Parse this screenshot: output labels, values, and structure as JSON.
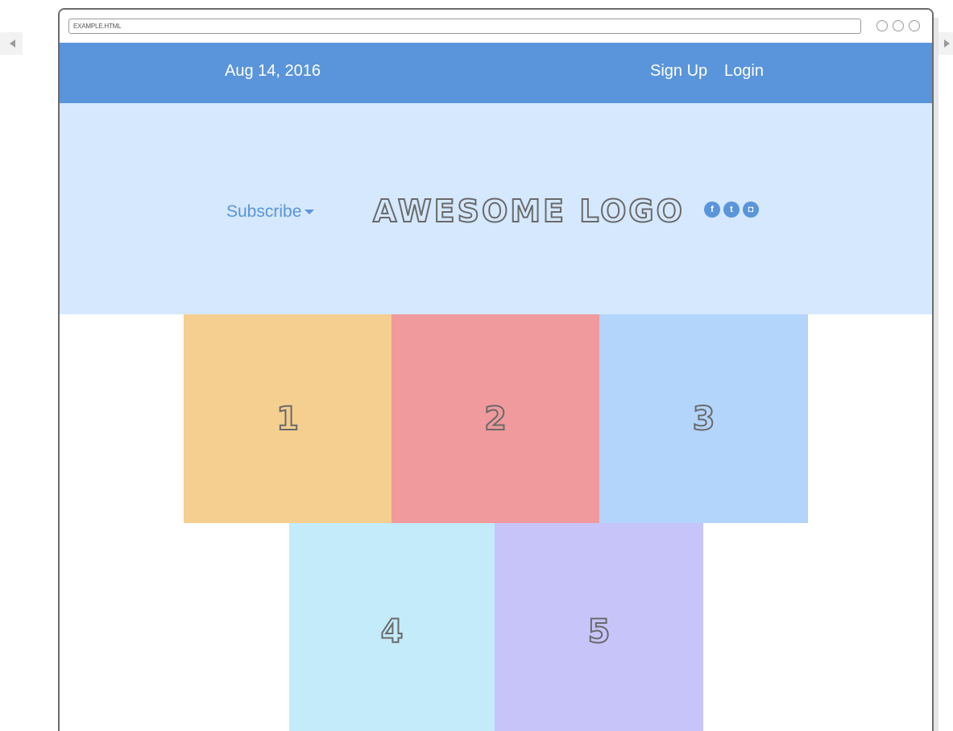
{
  "browser": {
    "url": "EXAMPLE.HTML"
  },
  "header": {
    "date": "Aug 14, 2016",
    "signup_label": "Sign Up",
    "login_label": "Login"
  },
  "hero": {
    "subscribe_label": "Subscribe",
    "logo_text": "AWESOME LOGO",
    "social_icons": [
      "facebook-icon",
      "twitter-icon",
      "instagram-icon"
    ]
  },
  "tiles": [
    {
      "label": "1",
      "color": "#f4cf90"
    },
    {
      "label": "2",
      "color": "#f09a9d"
    },
    {
      "label": "3",
      "color": "#b3d5fc"
    },
    {
      "label": "4",
      "color": "#c3ebfa"
    },
    {
      "label": "5",
      "color": "#c7c4fa"
    }
  ],
  "colors": {
    "topbar": "#5a95db",
    "hero_background": "#d5e8fd",
    "accent": "#5a95db"
  }
}
